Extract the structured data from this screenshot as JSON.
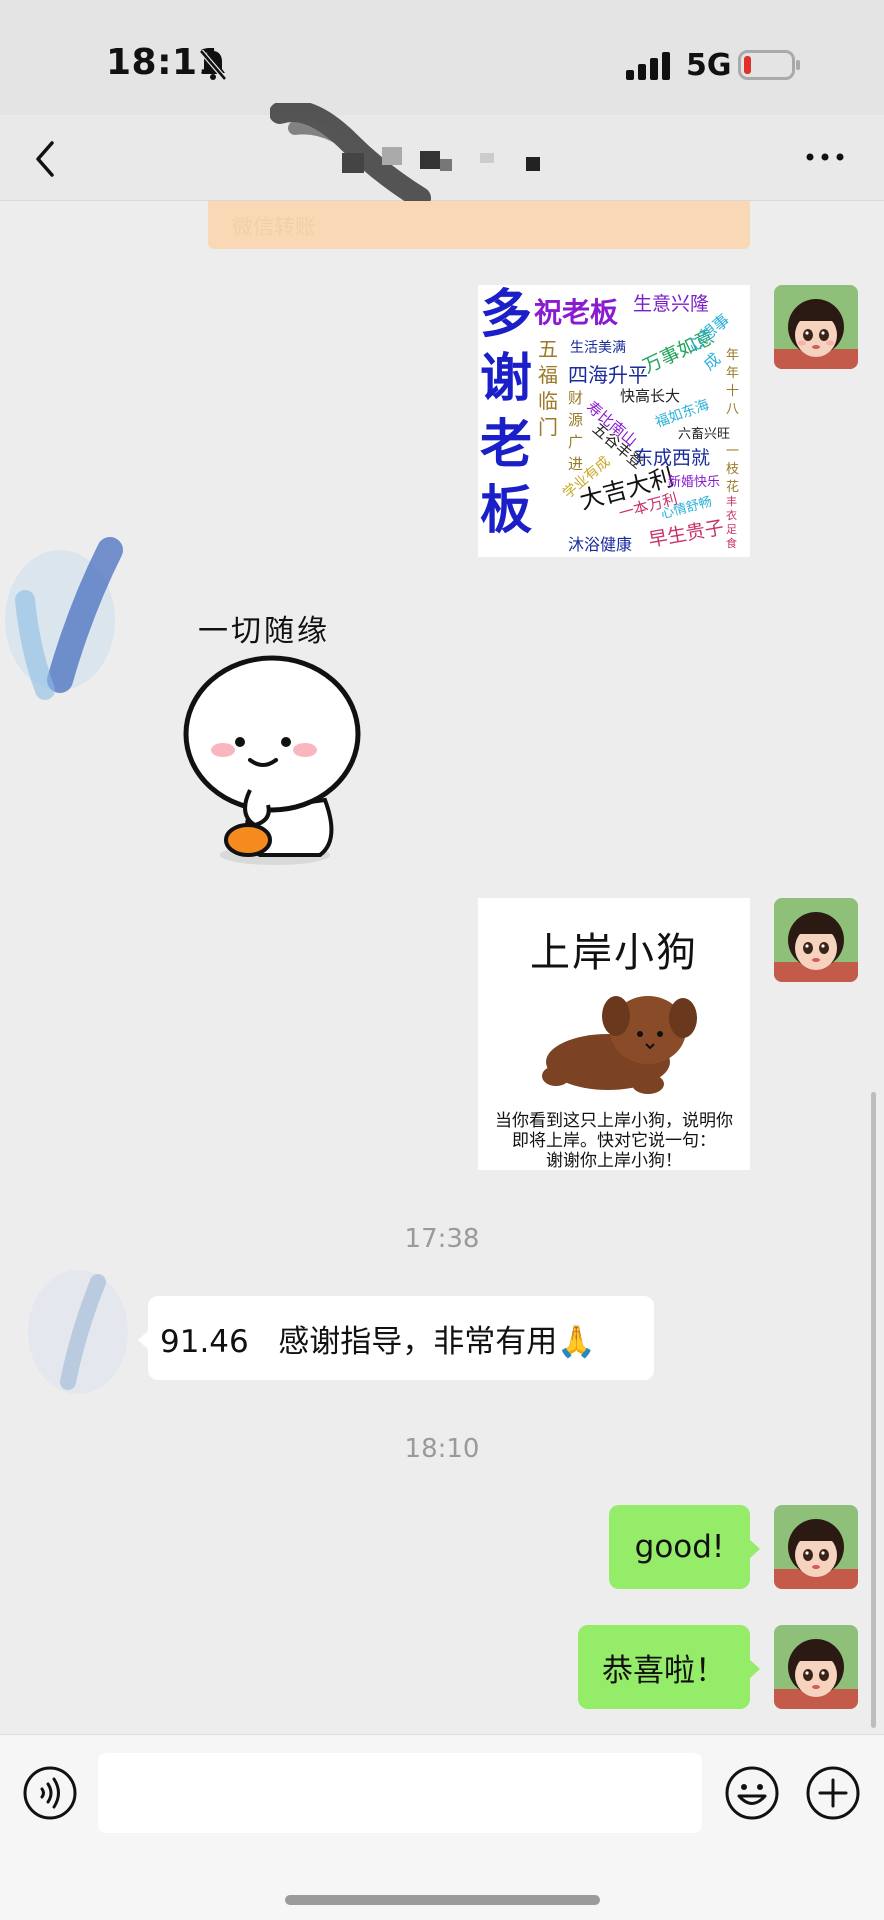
{
  "status_bar": {
    "time": "18:11",
    "network": "5G"
  },
  "header": {
    "title": "",
    "more_label": "..."
  },
  "transfer_card": {
    "label": "微信转账"
  },
  "messages": {
    "sticker_1": {
      "big_chars": [
        "多",
        "谢",
        "老",
        "板"
      ],
      "phrases": [
        "祝老板",
        "生意兴隆",
        "生活美满",
        "万事如意",
        "心想事成",
        "五",
        "福",
        "临",
        "门",
        "四海升平",
        "快高长大",
        "年年十八",
        "财",
        "源",
        "广",
        "进",
        "寿比南山",
        "五谷丰登",
        "福如东海",
        "六畜兴旺",
        "东成西就",
        "一枝花",
        "大吉大利",
        "学业有成",
        "新婚快乐",
        "丰衣足食",
        "一本万利",
        "心情舒畅",
        "早生贵子",
        "沐浴健康"
      ]
    },
    "sticker_2": {
      "caption": "一切随缘"
    },
    "sticker_3": {
      "title": "上岸小狗",
      "caption_lines": [
        "当你看到这只上岸小狗，说明你",
        "即将上岸。快对它说一句：",
        "谢谢你上岸小狗！"
      ]
    },
    "time_1": "17:38",
    "received_text": "91.46   感谢指导，非常有用🙏",
    "time_2": "18:10",
    "sent_1": "good!",
    "sent_2": "恭喜啦！"
  },
  "input_bar": {
    "placeholder": ""
  },
  "colors": {
    "sent_bubble": "#95ec69",
    "background": "#ededed",
    "transfer_card": "#f9d9b5"
  }
}
